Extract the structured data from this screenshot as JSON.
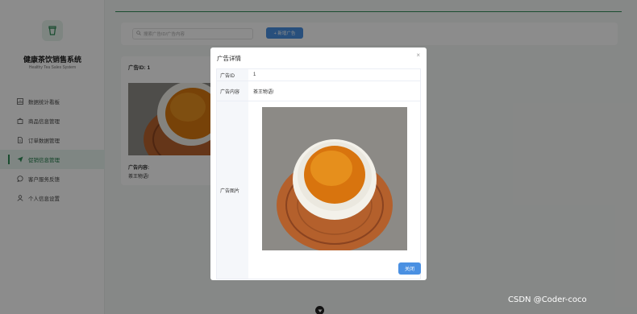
{
  "sidebar": {
    "title": "健康茶饮销售系统",
    "subtitle": "Healthy Tea Sales System",
    "items": [
      {
        "label": "数据统计看板",
        "icon": "chart-icon",
        "active": false
      },
      {
        "label": "商品信息管理",
        "icon": "bag-icon",
        "active": false
      },
      {
        "label": "订单数据管理",
        "icon": "document-icon",
        "active": false
      },
      {
        "label": "促销信息管理",
        "icon": "send-icon",
        "active": true
      },
      {
        "label": "客户服务反馈",
        "icon": "chat-icon",
        "active": false
      },
      {
        "label": "个人信息设置",
        "icon": "user-icon",
        "active": false
      }
    ]
  },
  "toolbar": {
    "search_placeholder": "搜索广告ID/广告内容",
    "add_label": "+ 新增广告"
  },
  "ad_card": {
    "id_label": "广告ID: 1",
    "content_label": "广告内容:",
    "content_value": "茶王物语!"
  },
  "modal": {
    "title": "广告详情",
    "close_icon": "×",
    "rows": {
      "id_label": "广告ID",
      "id_value": "1",
      "content_label": "广告内容",
      "content_value": "茶王物语!",
      "image_label": "广告图片"
    },
    "close_button": "关闭"
  },
  "watermark": "CSDN @Coder-coco",
  "colors": {
    "accent": "#2e8b57",
    "primary_button": "#4a90e2",
    "overlay": "rgba(0,0,0,0.45)"
  }
}
